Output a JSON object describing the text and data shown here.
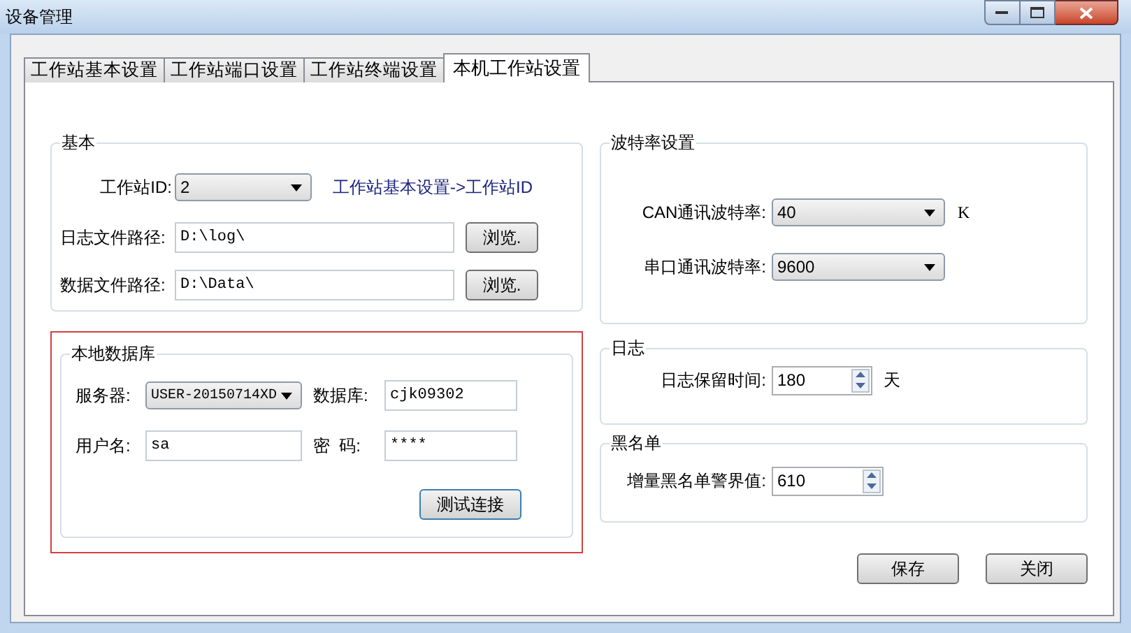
{
  "window": {
    "title": "设备管理"
  },
  "tabs": [
    {
      "label": "工作站基本设置",
      "selected": false
    },
    {
      "label": "工作站端口设置",
      "selected": false
    },
    {
      "label": "工作站终端设置",
      "selected": false
    },
    {
      "label": "本机工作站设置",
      "selected": true
    }
  ],
  "basic": {
    "title": "基本",
    "station_id": {
      "label": "工作站ID:",
      "value": "2"
    },
    "station_id_hint": "工作站基本设置->工作站ID",
    "log_path": {
      "label": "日志文件路径:",
      "value": "D:\\log\\",
      "button": "浏览."
    },
    "data_path": {
      "label": "数据文件路径:",
      "value": "D:\\Data\\",
      "button": "浏览."
    }
  },
  "local_database": {
    "title": "本地数据库",
    "highlighted": true,
    "server": {
      "label": "服务器:",
      "value": "USER-20150714XD"
    },
    "database": {
      "label": "数据库:",
      "value": "cjk09302"
    },
    "username": {
      "label": "用户名:",
      "value": "sa"
    },
    "password": {
      "label": "密  码:",
      "value": "****"
    },
    "test_button": "测试连接"
  },
  "baud_rate": {
    "title": "波特率设置",
    "can": {
      "label": "CAN通讯波特率:",
      "value": "40",
      "unit": "K"
    },
    "serial": {
      "label": "串口通讯波特率:",
      "value": "9600"
    }
  },
  "log": {
    "title": "日志",
    "retention": {
      "label": "日志保留时间:",
      "value": "180",
      "unit": "天"
    }
  },
  "blacklist": {
    "title": "黑名单",
    "threshold": {
      "label": "增量黑名单警界值:",
      "value": "610"
    }
  },
  "buttons": [
    "保存",
    "关闭"
  ]
}
